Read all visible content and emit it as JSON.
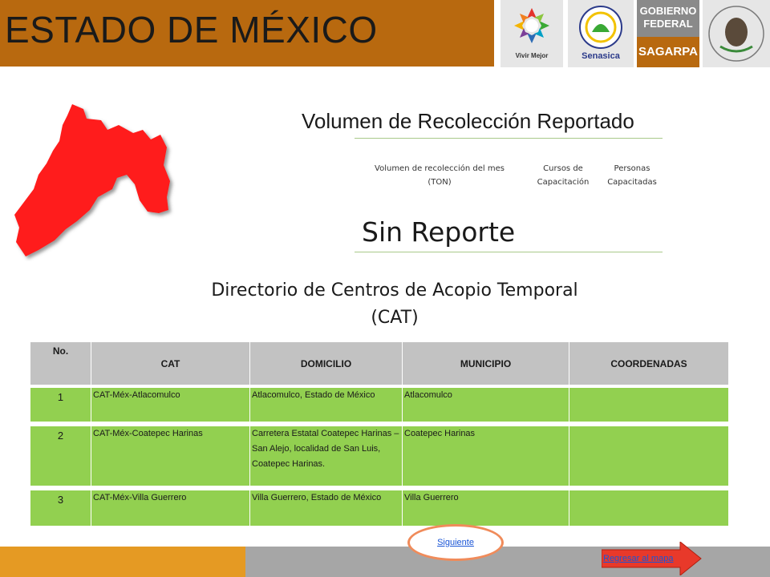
{
  "banner": {
    "title": "ESTADO DE MÉXICO"
  },
  "logos": {
    "vivir_mejor": "Vivir Mejor",
    "senasica": "Senasica",
    "gobierno_line1": "GOBIERNO",
    "gobierno_line2": "FEDERAL",
    "sagarpa": "SAGARPA"
  },
  "report": {
    "title": "Volumen de Recolección Reportado",
    "columns": [
      "Volumen de recolección del mes (TON)",
      "Cursos de Capacitación",
      "Personas Capacitadas"
    ],
    "status": "Sin Reporte"
  },
  "directory": {
    "title_line1": "Directorio de Centros de Acopio Temporal",
    "title_line2": "(CAT)",
    "headers": [
      "No.",
      "CAT",
      "DOMICILIO",
      "MUNICIPIO",
      "COORDENADAS"
    ],
    "rows": [
      {
        "no": "1",
        "cat": "CAT-Méx-Atlacomulco",
        "domicilio": "Atlacomulco, Estado de México",
        "municipio": "Atlacomulco",
        "coordenadas": ""
      },
      {
        "no": "2",
        "cat": "CAT-Méx-Coatepec Harinas",
        "domicilio": "Carretera Estatal Coatepec Harinas – San Alejo, localidad de San Luis, Coatepec Harinas.",
        "municipio": "Coatepec Harinas",
        "coordenadas": ""
      },
      {
        "no": "3",
        "cat": "CAT-Méx-Villa Guerrero",
        "domicilio": "Villa Guerrero, Estado de México",
        "municipio": "Villa Guerrero",
        "coordenadas": ""
      }
    ]
  },
  "nav": {
    "siguiente": "Siguiente",
    "regresar": "Regresar al mapa"
  },
  "colors": {
    "banner": "#b8690f",
    "map_fill": "#ff1a1a",
    "row_green": "#92d050",
    "header_gray": "#c2c2c2",
    "footer_orange": "#e59a23",
    "footer_gray": "#a6a6a6"
  }
}
